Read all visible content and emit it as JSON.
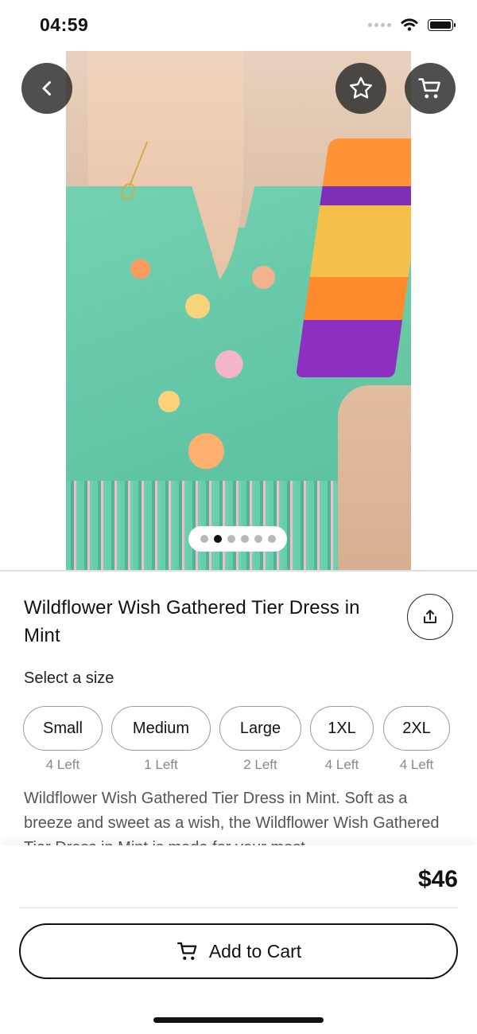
{
  "status": {
    "time": "04:59"
  },
  "product": {
    "title": "Wildflower Wish Gathered Tier Dress in Mint",
    "size_prompt": "Select a size",
    "sizes": [
      {
        "label": "Small",
        "stock": "4 Left"
      },
      {
        "label": "Medium",
        "stock": "1 Left"
      },
      {
        "label": "Large",
        "stock": "2 Left"
      },
      {
        "label": "1XL",
        "stock": "4 Left"
      },
      {
        "label": "2XL",
        "stock": "4 Left"
      }
    ],
    "description": "Wildflower Wish Gathered Tier Dress in Mint. Soft as a breeze and sweet as a wish, the Wildflower Wish Gathered Tier Dress in Mint is made for your most",
    "price": "$46"
  },
  "gallery": {
    "active_index": 1,
    "count": 6
  },
  "actions": {
    "add_to_cart": "Add to Cart"
  },
  "icons": {
    "back": "back-icon",
    "favorite": "star-icon",
    "cart": "cart-icon",
    "share": "share-icon"
  }
}
